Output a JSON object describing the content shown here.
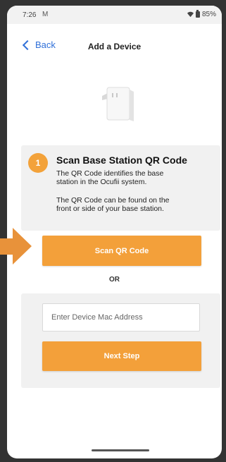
{
  "status": {
    "time": "7:26",
    "notification_icon": "M",
    "battery": "85%"
  },
  "nav": {
    "back_label": "Back",
    "title": "Add a Device"
  },
  "step": {
    "number": "1",
    "title": "Scan Base Station QR Code",
    "text1a": "The QR Code identifies the base",
    "text1b": "station in the Ocufii system.",
    "text2a": "The QR Code can be found on the",
    "text2b": "front or side of your base station."
  },
  "actions": {
    "scan_label": "Scan QR Code",
    "or_label": "OR",
    "mac_placeholder": "Enter Device Mac Address",
    "next_label": "Next Step"
  },
  "colors": {
    "accent": "#f3a03a",
    "link": "#2f6fd8",
    "card": "#f1f1f1",
    "frame": "#333333"
  }
}
